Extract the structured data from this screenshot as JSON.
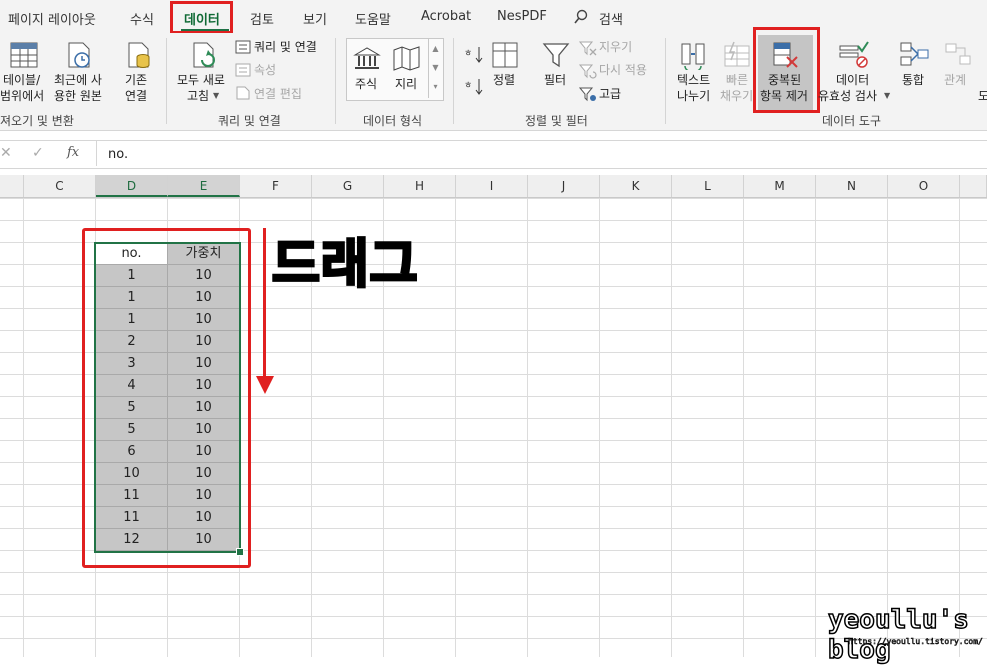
{
  "tabs": [
    {
      "label": "페이지 레이아웃"
    },
    {
      "label": "수식"
    },
    {
      "label": "데이터"
    },
    {
      "label": "검토"
    },
    {
      "label": "보기"
    },
    {
      "label": "도움말"
    },
    {
      "label": "Acrobat"
    },
    {
      "label": "NesPDF"
    },
    {
      "label": "검색"
    }
  ],
  "ribbon": {
    "groups": {
      "get_transform": "져오기 및 변환",
      "queries": "쿼리 및 연결",
      "data_types": "데이터 형식",
      "sort_filter": "정렬 및 필터",
      "data_tools": "데이터 도구"
    },
    "buttons": {
      "table_range_1": "테이블/",
      "table_range_2": "범위에서",
      "recent_1": "최근에 사",
      "recent_2": "용한 원본",
      "existing_1": "기존",
      "existing_2": "연결",
      "refresh_1": "모두 새로",
      "refresh_2": "고침",
      "queries_conn": "쿼리 및 연결",
      "properties": "속성",
      "edit_links": "연결 편집",
      "stocks": "주식",
      "geography": "지리",
      "sort": "정렬",
      "filter": "필터",
      "clear": "지우기",
      "reapply": "다시 적용",
      "advanced": "고급",
      "text_col_1": "텍스트",
      "text_col_2": "나누기",
      "flash_1": "빠른",
      "flash_2": "채우기",
      "dedupe_1": "중복된",
      "dedupe_2": "항목 제거",
      "validate_1": "데이터",
      "validate_2": "유효성 검사",
      "consolidate": "통합",
      "relations": "관계",
      "more": "도"
    }
  },
  "formula_bar": {
    "fx": "fx",
    "value": "no."
  },
  "columns": [
    "C",
    "D",
    "E",
    "F",
    "G",
    "H",
    "I",
    "J",
    "K",
    "L",
    "M",
    "N",
    "O"
  ],
  "table": {
    "headers": [
      "no.",
      "가중치"
    ],
    "rows": [
      [
        "1",
        "10"
      ],
      [
        "1",
        "10"
      ],
      [
        "1",
        "10"
      ],
      [
        "2",
        "10"
      ],
      [
        "3",
        "10"
      ],
      [
        "4",
        "10"
      ],
      [
        "5",
        "10"
      ],
      [
        "5",
        "10"
      ],
      [
        "6",
        "10"
      ],
      [
        "10",
        "10"
      ],
      [
        "11",
        "10"
      ],
      [
        "11",
        "10"
      ],
      [
        "12",
        "10"
      ]
    ]
  },
  "annotation": {
    "drag_text": "드래그"
  },
  "watermark": {
    "main": "yeoullu's blog",
    "sub": "https://yeoullu.tistory.com/"
  },
  "colors": {
    "accent": "#217346",
    "highlight_red": "#e02020"
  }
}
